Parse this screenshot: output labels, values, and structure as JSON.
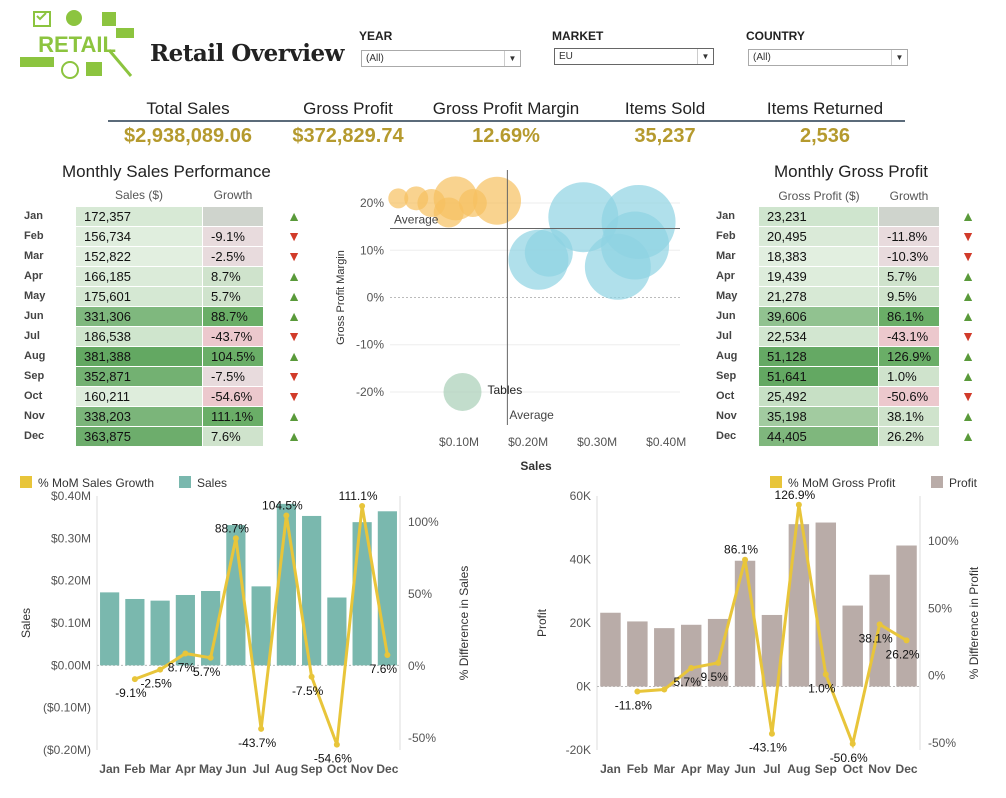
{
  "app": {
    "title": "Retail Overview",
    "logo_text": "RETAIL"
  },
  "filters": [
    {
      "label": "YEAR",
      "value": "(All)"
    },
    {
      "label": "MARKET",
      "value": "EU"
    },
    {
      "label": "COUNTRY",
      "value": "(All)"
    }
  ],
  "kpis": [
    {
      "label": "Total Sales",
      "value": "$2,938,089.06"
    },
    {
      "label": "Gross Profit",
      "value": "$372,829.74"
    },
    {
      "label": "Gross Profit Margin",
      "value": "12.69%"
    },
    {
      "label": "Items Sold",
      "value": "35,237"
    },
    {
      "label": "Items Returned",
      "value": "2,536"
    }
  ],
  "colors": {
    "accent": "#b59a2e",
    "up": "#5a9a3a",
    "down": "#d13b2a",
    "teal": "#7ab8ae",
    "taupe": "#b9aca8",
    "line": "#e8c53a",
    "orange": "#f7c060",
    "blue": "#8fd3e3",
    "bubble_green": "#a8cfb7"
  },
  "months": [
    "Jan",
    "Feb",
    "Mar",
    "Apr",
    "May",
    "Jun",
    "Jul",
    "Aug",
    "Sep",
    "Oct",
    "Nov",
    "Dec"
  ],
  "sales_table": {
    "title": "Monthly Sales Performance",
    "col_sales": "Sales ($)",
    "col_growth": "Growth",
    "sales": [
      "172,357",
      "156,734",
      "152,822",
      "166,185",
      "175,601",
      "331,306",
      "186,538",
      "381,388",
      "352,871",
      "160,211",
      "338,203",
      "363,875"
    ],
    "growth": [
      "",
      "-9.1%",
      "-2.5%",
      "8.7%",
      "5.7%",
      "88.7%",
      "-43.7%",
      "104.5%",
      "-7.5%",
      "-54.6%",
      "111.1%",
      "7.6%"
    ],
    "direction": [
      "up",
      "down",
      "down",
      "up",
      "up",
      "up",
      "down",
      "up",
      "down",
      "down",
      "up",
      "up"
    ]
  },
  "profit_table": {
    "title": "Monthly Gross Profit",
    "col_profit": "Gross Profit ($)",
    "col_growth": "Growth",
    "profit": [
      "23,231",
      "20,495",
      "18,383",
      "19,439",
      "21,278",
      "39,606",
      "22,534",
      "51,128",
      "51,641",
      "25,492",
      "35,198",
      "44,405"
    ],
    "growth": [
      "",
      "-11.8%",
      "-10.3%",
      "5.7%",
      "9.5%",
      "86.1%",
      "-43.1%",
      "126.9%",
      "1.0%",
      "-50.6%",
      "38.1%",
      "26.2%"
    ],
    "direction": [
      "up",
      "down",
      "down",
      "up",
      "up",
      "up",
      "down",
      "up",
      "up",
      "down",
      "up",
      "up"
    ]
  },
  "chart_data": [
    {
      "type": "scatter",
      "xlabel": "Sales",
      "ylabel": "Gross Profit Margin",
      "x_ticks": [
        "$0.10M",
        "$0.20M",
        "$0.30M",
        "$0.40M"
      ],
      "y_ticks": [
        "20%",
        "10%",
        "0%",
        "-10%",
        "-20%"
      ],
      "xlim": [
        0.0,
        0.42
      ],
      "ylim": [
        -0.27,
        0.27
      ],
      "reference_lines": [
        {
          "label": "Average",
          "axis": "y",
          "value": 0.146
        },
        {
          "label": "Average",
          "axis": "x",
          "value": 0.17
        }
      ],
      "annotations": [
        {
          "text": "Tables"
        }
      ],
      "points": [
        {
          "x": 0.012,
          "y": 0.21,
          "size": 10,
          "color": "orange"
        },
        {
          "x": 0.038,
          "y": 0.21,
          "size": 12,
          "color": "orange"
        },
        {
          "x": 0.06,
          "y": 0.2,
          "size": 14,
          "color": "orange"
        },
        {
          "x": 0.095,
          "y": 0.21,
          "size": 22,
          "color": "orange"
        },
        {
          "x": 0.085,
          "y": 0.18,
          "size": 15,
          "color": "orange"
        },
        {
          "x": 0.12,
          "y": 0.2,
          "size": 14,
          "color": "orange"
        },
        {
          "x": 0.155,
          "y": 0.205,
          "size": 24,
          "color": "orange"
        },
        {
          "x": 0.215,
          "y": 0.08,
          "size": 30,
          "color": "blue"
        },
        {
          "x": 0.23,
          "y": 0.095,
          "size": 24,
          "color": "blue"
        },
        {
          "x": 0.28,
          "y": 0.17,
          "size": 35,
          "color": "blue"
        },
        {
          "x": 0.33,
          "y": 0.065,
          "size": 33,
          "color": "blue"
        },
        {
          "x": 0.355,
          "y": 0.11,
          "size": 34,
          "color": "blue"
        },
        {
          "x": 0.36,
          "y": 0.16,
          "size": 37,
          "color": "blue"
        },
        {
          "x": 0.105,
          "y": -0.2,
          "size": 19,
          "color": "bubble_green"
        }
      ]
    },
    {
      "type": "bar",
      "title": "",
      "legend": [
        "% MoM Sales Growth",
        "Sales"
      ],
      "categories": [
        "Jan",
        "Feb",
        "Mar",
        "Apr",
        "May",
        "Jun",
        "Jul",
        "Aug",
        "Sep",
        "Oct",
        "Nov",
        "Dec"
      ],
      "series": [
        {
          "name": "Sales",
          "values": [
            0.172357,
            0.156734,
            0.152822,
            0.166185,
            0.175601,
            0.331306,
            0.186538,
            0.381388,
            0.352871,
            0.160211,
            0.338203,
            0.363875
          ]
        },
        {
          "name": "% MoM Sales Growth",
          "values": [
            -9.1,
            -2.5,
            8.7,
            5.7,
            88.7,
            -43.7,
            104.5,
            -7.5,
            -54.6,
            111.1,
            7.6
          ]
        }
      ],
      "point_labels": [
        "-9.1%",
        "-2.5%",
        "8.7%",
        "5.7%",
        "88.7%",
        "-43.7%",
        "104.5%",
        "-7.5%",
        "-54.6%",
        "111.1%",
        "7.6%"
      ],
      "ylabel": "Sales",
      "y2label": "% Difference in Sales",
      "y_ticks": [
        "$0.40M",
        "$0.30M",
        "$0.20M",
        "$0.10M",
        "$0.00M",
        "($0.10M)",
        "($0.20M)"
      ],
      "y2_ticks": [
        "100%",
        "50%",
        "0%",
        "-50%"
      ],
      "ylim": [
        -0.2,
        0.4
      ],
      "y2lim": [
        -50,
        100
      ]
    },
    {
      "type": "bar",
      "title": "",
      "legend": [
        "% MoM Gross Profit",
        "Profit"
      ],
      "categories": [
        "Jan",
        "Feb",
        "Mar",
        "Apr",
        "May",
        "Jun",
        "Jul",
        "Aug",
        "Sep",
        "Oct",
        "Nov",
        "Dec"
      ],
      "series": [
        {
          "name": "Profit",
          "values": [
            23231,
            20495,
            18383,
            19439,
            21278,
            39606,
            22534,
            51128,
            51641,
            25492,
            35198,
            44405
          ]
        },
        {
          "name": "% MoM Gross Profit",
          "values": [
            -11.8,
            -10.3,
            5.7,
            9.5,
            86.1,
            -43.1,
            126.9,
            1.0,
            -50.6,
            38.1,
            26.2
          ]
        }
      ],
      "point_labels": [
        "-11.8%",
        "",
        "5.7%",
        "9.5%",
        "86.1%",
        "-43.1%",
        "126.9%",
        "1.0%",
        "-50.6%",
        "38.1%",
        "26.2%"
      ],
      "ylabel": "Profit",
      "y2label": "% Difference in Profit",
      "y_ticks": [
        "60K",
        "40K",
        "20K",
        "0K",
        "-20K"
      ],
      "y2_ticks": [
        "100%",
        "50%",
        "0%",
        "-50%"
      ],
      "ylim": [
        -20000,
        60000
      ],
      "y2lim": [
        -50,
        100
      ]
    }
  ]
}
